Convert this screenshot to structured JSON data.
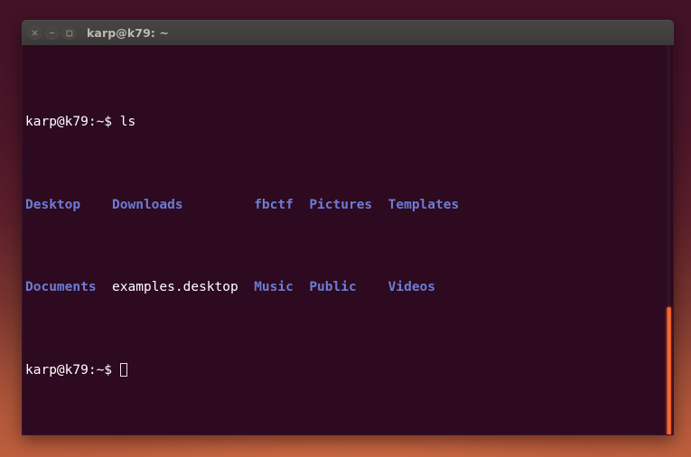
{
  "window": {
    "title": "karp@k79: ~",
    "controls": [
      {
        "name": "close-button",
        "glyph": "×"
      },
      {
        "name": "minimize-button",
        "glyph": "−"
      },
      {
        "name": "maximize-button",
        "glyph": "□"
      }
    ]
  },
  "terminal": {
    "prompt": "karp@k79:~$ ",
    "command": "ls",
    "lines": [
      {
        "type": "command",
        "prompt": "karp@k79:~$ ",
        "command": "ls"
      },
      {
        "type": "output",
        "cells": [
          {
            "text": "Desktop",
            "kind": "dir"
          },
          {
            "text": "Downloads",
            "kind": "dir"
          },
          {
            "text": "fbctf",
            "kind": "dir"
          },
          {
            "text": "Pictures",
            "kind": "dir"
          },
          {
            "text": "Templates",
            "kind": "dir"
          }
        ]
      },
      {
        "type": "output",
        "cells": [
          {
            "text": "Documents",
            "kind": "dir"
          },
          {
            "text": "examples.desktop",
            "kind": "file"
          },
          {
            "text": "Music",
            "kind": "dir"
          },
          {
            "text": "Public",
            "kind": "dir"
          },
          {
            "text": "Videos",
            "kind": "dir"
          }
        ]
      },
      {
        "type": "prompt",
        "prompt": "karp@k79:~$ ",
        "cursor": true
      }
    ],
    "row1": "Desktop    Downloads         fbctf  Pictures  Templates",
    "row2": "Documents  examples.desktop  Music  Public    Videos"
  },
  "colors": {
    "terminal_background": "#2d0a20",
    "terminal_foreground": "#ffffff",
    "directory_color": "#6c7cd4",
    "titlebar_background": "#434140",
    "titlebar_text": "#bdbab5",
    "scrollbar_accent": "#f4703a",
    "wallpaper_top": "#421227",
    "wallpaper_bottom": "#bf6440"
  }
}
